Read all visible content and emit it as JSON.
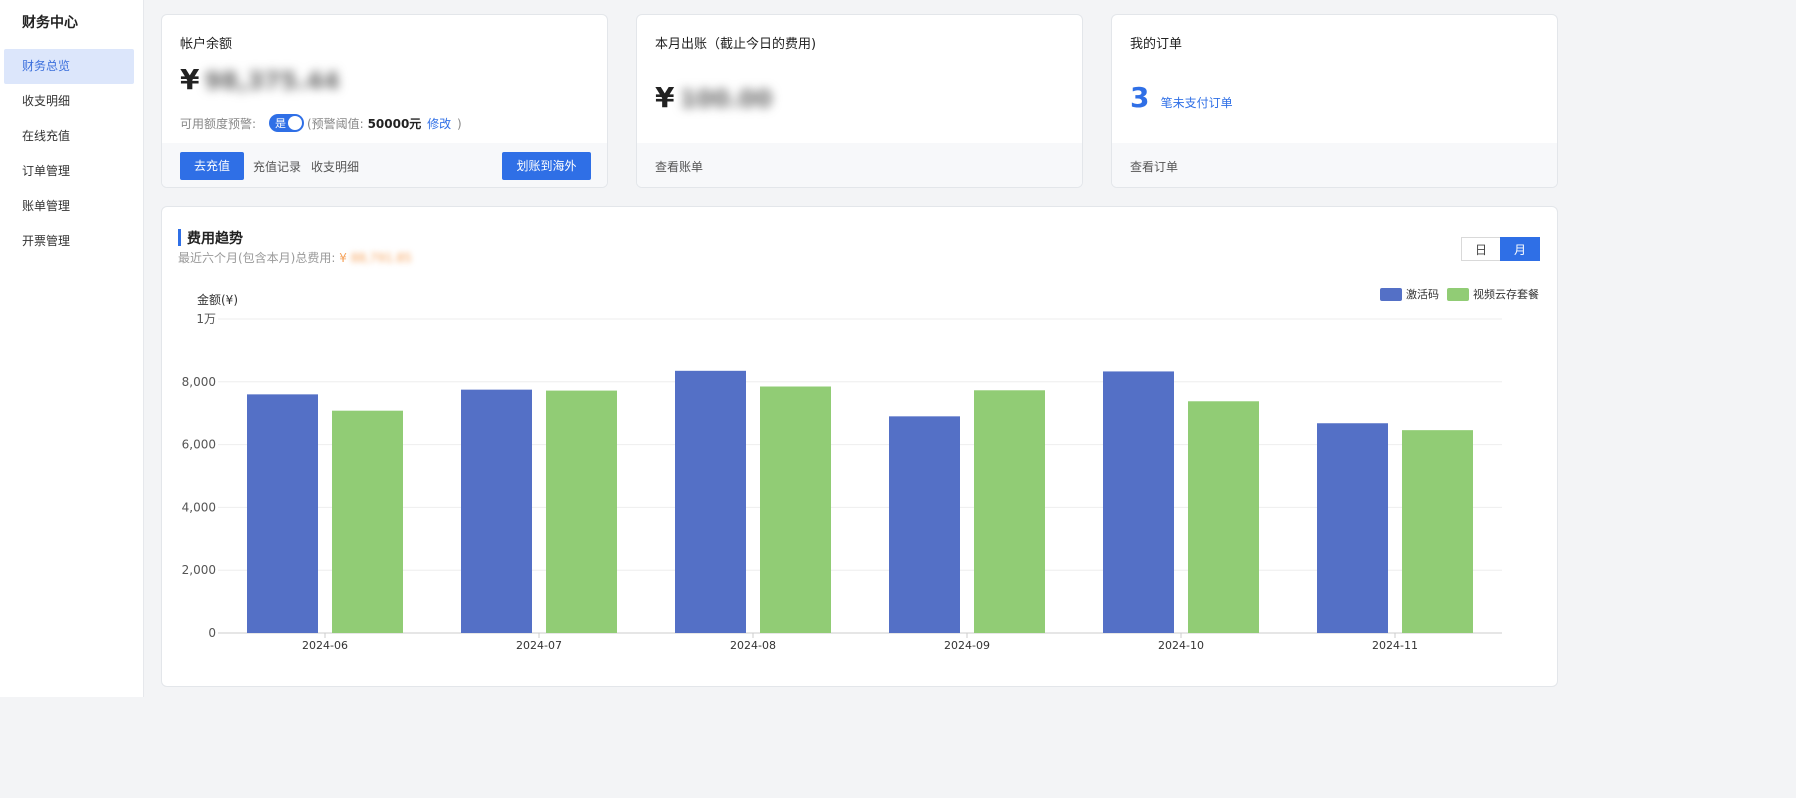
{
  "sidebar": {
    "title": "财务中心",
    "items": [
      {
        "label": "财务总览",
        "active": true
      },
      {
        "label": "收支明细",
        "active": false
      },
      {
        "label": "在线充值",
        "active": false
      },
      {
        "label": "订单管理",
        "active": false
      },
      {
        "label": "账单管理",
        "active": false
      },
      {
        "label": "开票管理",
        "active": false
      }
    ]
  },
  "balance_card": {
    "title": "帐户余额",
    "currency": "¥",
    "amount_blurred": "98,375.44",
    "alert_label": "可用额度预警:",
    "toggle_text": "是",
    "threshold_prefix": "(预警阈值:",
    "threshold_value": "50000元",
    "modify_link": "修改",
    "threshold_suffix": ")",
    "recharge_button": "去充值",
    "recharge_record_link": "充值记录",
    "statement_link": "收支明细",
    "transfer_button": "划账到海外"
  },
  "bill_card": {
    "title": "本月出账（截止今日的费用)",
    "currency": "¥",
    "amount_blurred": "100.00",
    "footer_link": "查看账单"
  },
  "order_card": {
    "title": "我的订单",
    "count": "3",
    "count_label": "笔未支付订单",
    "footer_link": "查看订单"
  },
  "trend": {
    "title": "费用趋势",
    "subtitle": "最近六个月(包含本月)总费用:",
    "subtitle_currency": "¥",
    "subtitle_amount_blurred": "88,791.85",
    "toggle_day": "日",
    "toggle_month": "月",
    "active_period": "月"
  },
  "chart_data": {
    "type": "bar",
    "ylabel": "金额(¥)",
    "ylim": [
      0,
      10000
    ],
    "yticks": [
      {
        "value": 0,
        "label": "0"
      },
      {
        "value": 2000,
        "label": "2,000"
      },
      {
        "value": 4000,
        "label": "4,000"
      },
      {
        "value": 6000,
        "label": "6,000"
      },
      {
        "value": 8000,
        "label": "8,000"
      },
      {
        "value": 10000,
        "label": "1万"
      }
    ],
    "categories": [
      "2024-06",
      "2024-07",
      "2024-08",
      "2024-09",
      "2024-10",
      "2024-11"
    ],
    "series": [
      {
        "name": "激活码",
        "color": "#5470c6",
        "values": [
          7600,
          7750,
          8350,
          6900,
          8330,
          6680
        ]
      },
      {
        "name": "视频云存套餐",
        "color": "#91cc75",
        "values": [
          7080,
          7720,
          7850,
          7730,
          7380,
          6460
        ]
      }
    ],
    "legend_position": "top-right",
    "grid": true
  },
  "colors": {
    "accent": "#2f6fe6",
    "active_nav_bg": "#dce6fb",
    "trend_accent_bar": "#2f6fe6",
    "blurred_orange": "#f5a15a"
  }
}
